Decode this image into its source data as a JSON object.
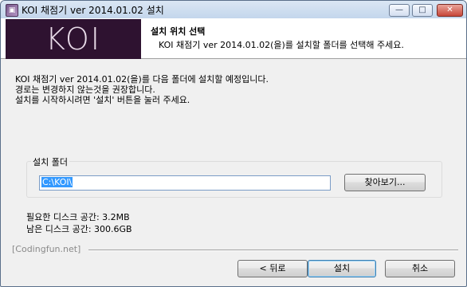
{
  "window": {
    "title": "KOI 채점기 ver 2014.01.02 설치",
    "minimize_glyph": "—",
    "maximize_glyph": "□",
    "close_glyph": "✕"
  },
  "header": {
    "logo_text": "KOI",
    "title": "설치 위치 선택",
    "subtitle": "KOI 채점기 ver 2014.01.02(을)를 설치할 폴더를 선택해 주세요."
  },
  "intro": {
    "lines": [
      "KOI 채점기 ver 2014.01.02(을)를 다음 폴더에 설치할 예정입니다.",
      "경로는 변경하지 않는것을 권장합니다.",
      "설치를 시작하시려면 '설치' 버튼을 눌러 주세요."
    ]
  },
  "folder": {
    "group_label": "설치 폴더",
    "path_value": "C:\\KOI\\",
    "browse_label": "찾아보기..."
  },
  "disk": {
    "required": "필요한 디스크 공간: 3.2MB",
    "available": "남은 디스크 공간: 300.6GB"
  },
  "footer": {
    "brand": "[Codingfun.net]",
    "back_label": "< 뒤로",
    "install_label": "설치",
    "cancel_label": "취소"
  },
  "icons": {
    "app": "app-icon",
    "minimize": "minimize-icon",
    "maximize": "maximize-icon",
    "close": "close-icon"
  }
}
